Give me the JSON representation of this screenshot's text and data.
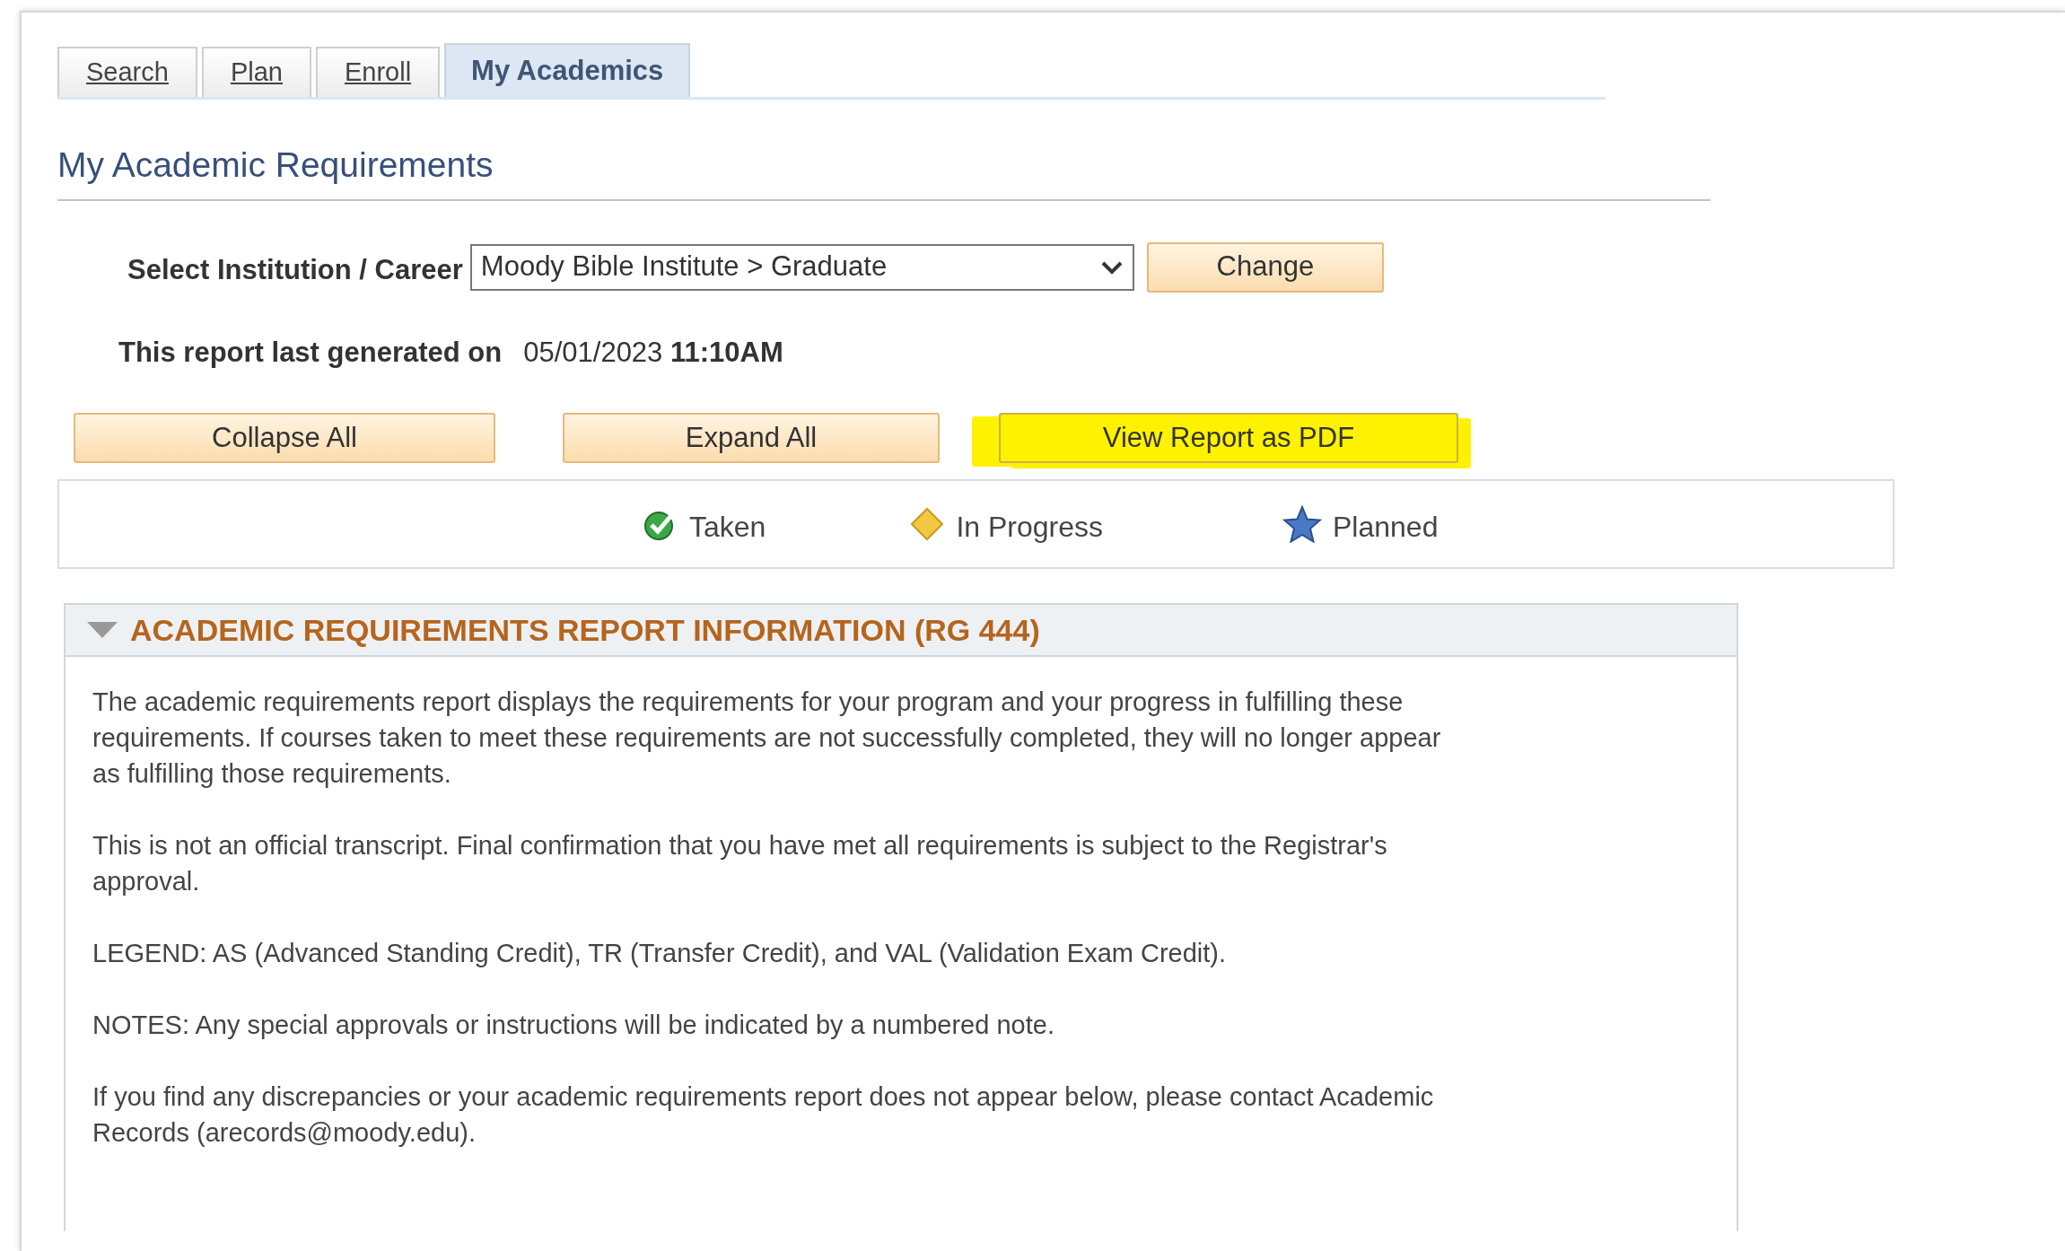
{
  "tabs": [
    {
      "label": "Search",
      "selected": false
    },
    {
      "label": "Plan",
      "selected": false
    },
    {
      "label": "Enroll",
      "selected": false
    },
    {
      "label": "My Academics",
      "selected": true
    }
  ],
  "heading": "My Academic Requirements",
  "institution": {
    "label": "Select Institution / Career",
    "value": "Moody Bible Institute > Graduate",
    "button": "Change"
  },
  "generated": {
    "label": "This report last generated on",
    "date": "05/01/2023",
    "time": "11:10AM"
  },
  "actions": [
    {
      "label": "Collapse All",
      "highlighted": false
    },
    {
      "label": "Expand All",
      "highlighted": false
    },
    {
      "label": "View Report as PDF",
      "highlighted": true
    }
  ],
  "legend": [
    {
      "kind": "check",
      "label": "Taken"
    },
    {
      "kind": "diamond",
      "label": "In Progress"
    },
    {
      "kind": "star",
      "label": "Planned"
    }
  ],
  "panel": {
    "title": "ACADEMIC REQUIREMENTS REPORT INFORMATION (RG 444)",
    "expanded": true,
    "paragraphs": [
      "The academic requirements report displays the requirements for your program and your progress in fulfilling these requirements. If courses taken to meet these requirements are not successfully completed, they will no longer appear as fulfilling those requirements.",
      "This is not an official transcript. Final confirmation that you have met all requirements is subject to the Registrar's approval.",
      "LEGEND: AS (Advanced Standing Credit), TR (Transfer Credit), and VAL (Validation Exam Credit).",
      "NOTES: Any special approvals or instructions will be indicated by a numbered note.",
      "If you find any discrepancies or your academic requirements report does not appear below, please contact Academic Records (arecords@moody.edu)."
    ]
  }
}
